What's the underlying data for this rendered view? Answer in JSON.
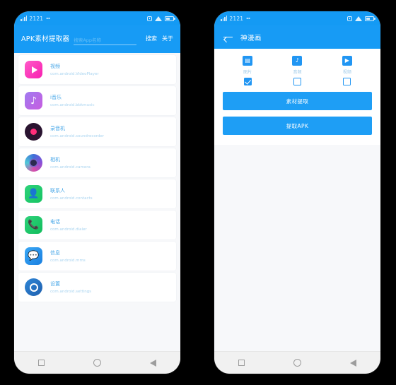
{
  "status_bar": {
    "time": "2121",
    "signal_icon": "signal-bars-icon",
    "alarm_icon": "alarm-icon",
    "wifi_icon": "wifi-icon",
    "battery_icon": "battery-icon"
  },
  "left_phone": {
    "appbar": {
      "title": "APK素材提取器",
      "search_placeholder": "搜索App名称",
      "search_value": "",
      "search_button": "搜索",
      "about_button": "关于"
    },
    "apps": [
      {
        "name": "视频",
        "package": "com.android.VideoPlayer",
        "icon": "video-player-icon"
      },
      {
        "name": "i音乐",
        "package": "com.android.bbkmusic",
        "icon": "music-icon"
      },
      {
        "name": "录音机",
        "package": "com.android.soundrecorder",
        "icon": "sound-recorder-icon"
      },
      {
        "name": "相机",
        "package": "com.android.camera",
        "icon": "camera-icon"
      },
      {
        "name": "联系人",
        "package": "com.android.contacts",
        "icon": "contacts-icon"
      },
      {
        "name": "电话",
        "package": "com.android.dialer",
        "icon": "phone-icon"
      },
      {
        "name": "信息",
        "package": "com.android.mms",
        "icon": "message-icon"
      },
      {
        "name": "设置",
        "package": "com.android.settings",
        "icon": "settings-icon"
      }
    ]
  },
  "right_phone": {
    "appbar": {
      "back_icon": "back-arrow-icon",
      "title": "神漫画"
    },
    "options": [
      {
        "label": "图片",
        "icon": "image-icon",
        "glyph": "▤",
        "checked": true
      },
      {
        "label": "音频",
        "icon": "audio-icon",
        "glyph": "♪",
        "checked": false
      },
      {
        "label": "视频",
        "icon": "video-icon",
        "glyph": "▶",
        "checked": false
      }
    ],
    "buttons": {
      "extract_assets": "素材提取",
      "extract_apk": "提取APK"
    }
  },
  "navbar": {
    "recents_icon": "square-recents-icon",
    "home_icon": "circle-home-icon",
    "back_icon": "triangle-back-icon"
  },
  "colors": {
    "primary": "#179bf5",
    "statusbar": "#149af4",
    "button": "#1e9ef5",
    "page_bg": "#f7f8fa"
  }
}
